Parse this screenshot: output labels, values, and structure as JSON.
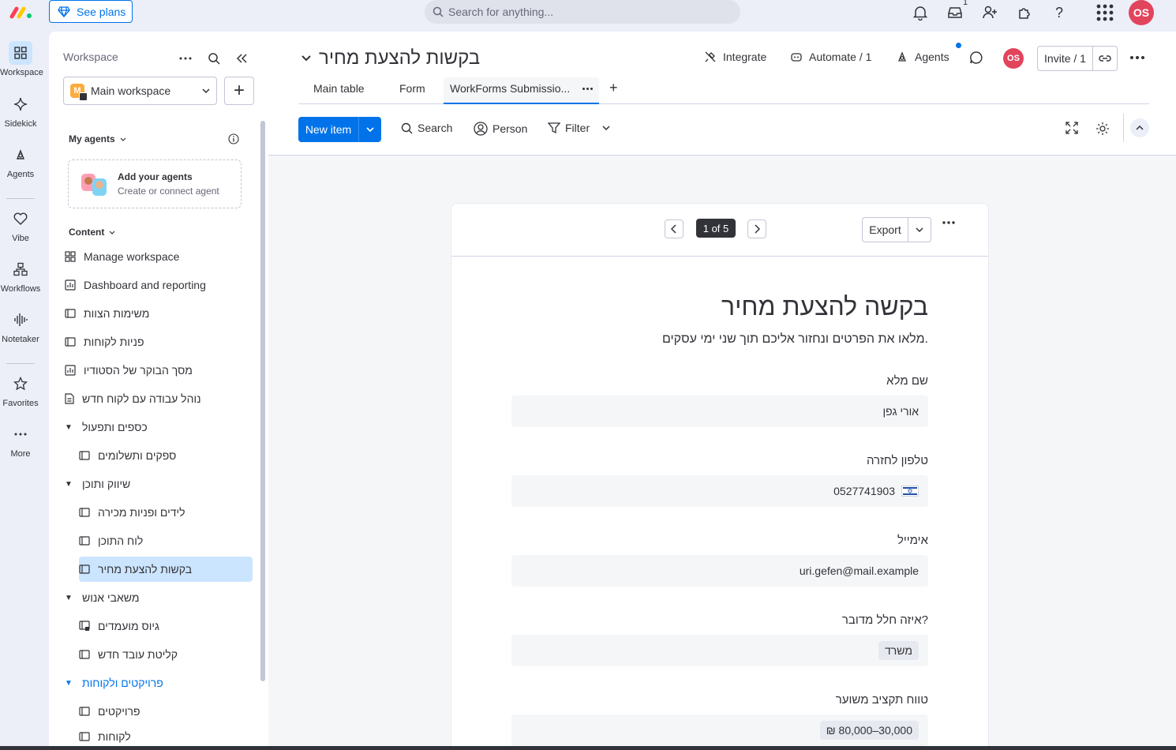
{
  "topbar": {
    "see_plans": "See plans",
    "search_placeholder": "Search for anything...",
    "inbox_badge": "1",
    "user_initials": "OS"
  },
  "rail": {
    "items": [
      {
        "label": "Workspace",
        "icon": "grid-icon"
      },
      {
        "label": "Sidekick",
        "icon": "sparkle-icon"
      },
      {
        "label": "Agents",
        "icon": "agent-icon"
      },
      {
        "label": "Vibe",
        "icon": "heart-icon"
      },
      {
        "label": "Workflows",
        "icon": "workflow-icon"
      },
      {
        "label": "Notetaker",
        "icon": "waveform-icon"
      },
      {
        "label": "Favorites",
        "icon": "star-icon"
      },
      {
        "label": "More",
        "icon": "more-icon"
      }
    ]
  },
  "sidebar": {
    "title": "Workspace",
    "workspace_name": "Main workspace",
    "workspace_initial": "M",
    "my_agents_label": "My agents",
    "agents_card_title": "Add your agents",
    "agents_card_sub": "Create or connect agent",
    "content_label": "Content",
    "items": [
      {
        "label": "Manage workspace"
      },
      {
        "label": "Dashboard and reporting"
      },
      {
        "label": "משימות הצוות"
      },
      {
        "label": "פניות לקוחות"
      },
      {
        "label": "מסך הבוקר של הסטודיו"
      },
      {
        "label": "נוהל עבודה עם לקוח חדש"
      },
      {
        "label": "כספים ותפעול"
      },
      {
        "label": "ספקים ותשלומים"
      },
      {
        "label": "שיווק ותוכן"
      },
      {
        "label": "לידים ופניות מכירה"
      },
      {
        "label": "לוח התוכן"
      },
      {
        "label": "בקשות להצעת מחיר"
      },
      {
        "label": "משאבי אנוש"
      },
      {
        "label": "גיוס מועמדים"
      },
      {
        "label": "קליטת עובד חדש"
      },
      {
        "label": "פרויקטים ולקוחות"
      },
      {
        "label": "פרויקטים"
      },
      {
        "label": "לקוחות"
      }
    ]
  },
  "board": {
    "title": "בקשות להצעת מחיר",
    "integrate": "Integrate",
    "automate": "Automate / 1",
    "agents": "Agents",
    "user_initials": "OS",
    "invite": "Invite / 1",
    "tabs": [
      {
        "label": "Main table"
      },
      {
        "label": "Form"
      },
      {
        "label": "WorkForms Submissio..."
      }
    ],
    "new_item": "New item",
    "search": "Search",
    "person": "Person",
    "filter": "Filter"
  },
  "submission": {
    "page_indicator": "1 of 5",
    "export": "Export",
    "form_title": "בקשה להצעת מחיר",
    "form_subtitle": ".מלאו את הפרטים ונחזור אליכם תוך שני ימי עסקים",
    "fields": [
      {
        "label": "שם מלא",
        "value": "אורי גפן"
      },
      {
        "label": "טלפון לחזרה",
        "value": "0527741903"
      },
      {
        "label": "אימייל",
        "value": "uri.gefen@mail.example"
      },
      {
        "label": "?איזה חלל מדובר",
        "value": "משרד"
      },
      {
        "label": "טווח תקציב משוער",
        "value": "₪ 80,000–30,000"
      }
    ]
  },
  "colors": {
    "primary": "#0073ea",
    "avatar": "#e2445c",
    "selected": "#cce5ff"
  }
}
